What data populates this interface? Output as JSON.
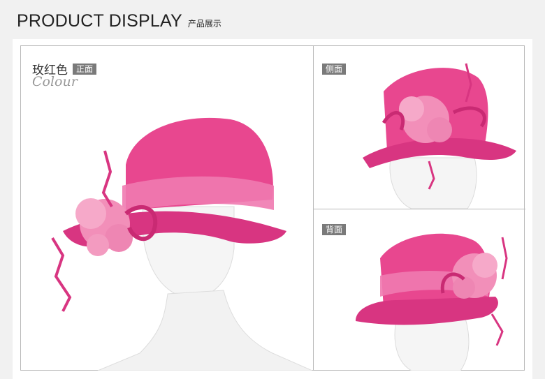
{
  "header": {
    "title": "PRODUCT DISPLAY",
    "subtitle": "产品展示"
  },
  "main_view": {
    "color_name": "玫红色",
    "view_tag": "正面",
    "colour_word": "Colour"
  },
  "side_view": {
    "tag": "侧面"
  },
  "back_view": {
    "tag": "背面"
  },
  "colors": {
    "hat": "#e8478f",
    "hat_dark": "#c92a73",
    "flower": "#f28fb9",
    "mannequin": "#f4f4f4",
    "tag_bg": "#7a7a7a",
    "border": "#b9b9b9"
  }
}
